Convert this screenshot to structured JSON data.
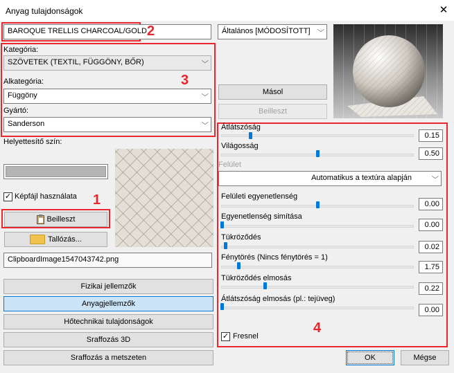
{
  "window": {
    "title": "Anyag tulajdonságok",
    "close_glyph": "✕"
  },
  "material_name": "BAROQUE TRELLIS CHARCOAL/GOLD",
  "preset_combo": "Általános [MÓDOSÍTOTT]",
  "category": {
    "label": "Kategória:",
    "value": "SZÖVETEK (TEXTIL, FÜGGÖNY, BŐR)",
    "sub_label": "Alkategória:",
    "sub_value": "Függöny",
    "maker_label": "Gyártó:",
    "maker_value": "Sanderson"
  },
  "substitute_color_label": "Helyettesítő szín:",
  "image_file": {
    "checkbox_label": "Képfájl használata",
    "checked": true,
    "paste_label": "Beilleszt",
    "browse_label": "Tallózás...",
    "filename": "ClipboardImage1547043742.png"
  },
  "copy_button": "Másol",
  "paste_button": "Beilleszt",
  "nav_buttons": [
    "Fizikai jellemzők",
    "Anyagjellemzők",
    "Hőtechnikai tulajdonságok",
    "Sraffozás 3D",
    "Sraffozás a metszeten"
  ],
  "properties": {
    "transparency": {
      "label": "Átlátszóság",
      "value": "0.15",
      "level": 0.15
    },
    "brightness": {
      "label": "Világosság",
      "value": "0.50",
      "level": 0.5
    },
    "surface_label": "Felület",
    "surface_value": "Automatikus a textúra alapján",
    "roughness": {
      "label": "Felületi egyenetlenség",
      "value": "0.00",
      "level": 0.5
    },
    "roughness_smooth": {
      "label": "Egyenetlenség simítása",
      "value": "0.00",
      "level": 0.0
    },
    "reflection": {
      "label": "Tükröződés",
      "value": "0.02",
      "level": 0.02
    },
    "refraction": {
      "label": "Fénytörés (Nincs fénytörés = 1)",
      "value": "1.75",
      "level": 0.08
    },
    "reflection_blur": {
      "label": "Tükröződés elmosás",
      "value": "0.22",
      "level": 0.22
    },
    "transparency_blur": {
      "label": "Átlátszóság elmosás (pl.: tejüveg)",
      "value": "0.00",
      "level": 0.0
    },
    "fresnel_label": "Fresnel",
    "fresnel_checked": true
  },
  "ok_button": "OK",
  "cancel_button": "Mégse",
  "annotations": {
    "n1": "1",
    "n2": "2",
    "n3": "3",
    "n4": "4"
  },
  "icons": {
    "paste": "clipboard-icon",
    "browse": "folder-icon"
  },
  "colors": {
    "annotation_red": "#e8262c",
    "accent_blue": "#0078d7",
    "active_button": "#cce4f7"
  }
}
